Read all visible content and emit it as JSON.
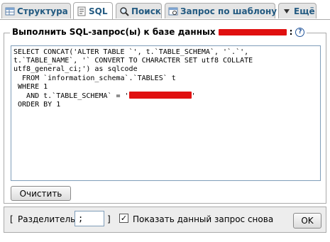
{
  "tabs": [
    {
      "label": "Структура",
      "icon": "structure-icon",
      "active": false
    },
    {
      "label": "SQL",
      "icon": "sql-icon",
      "active": true
    },
    {
      "label": "Поиск",
      "icon": "search-icon",
      "active": false
    },
    {
      "label": "Запрос по шаблону",
      "icon": "query-icon",
      "active": false
    },
    {
      "label": "Ещё",
      "icon": "chevron-down-icon",
      "active": false
    }
  ],
  "panel": {
    "legend": "Выполнить SQL-запрос(ы) к базе данных",
    "legend_suffix": ":",
    "help_icon": "help-icon",
    "sql_lines": [
      "SELECT CONCAT('ALTER TABLE `', t.`TABLE_SCHEMA`, '`.`',",
      "t.`TABLE_NAME`, '` CONVERT TO CHARACTER SET utf8 COLLATE",
      "utf8_general_ci;') as sqlcode",
      "  FROM `information_schema`.`TABLES` t",
      " WHERE 1",
      "   AND t.`TABLE_SCHEMA` = '",
      " ORDER BY 1"
    ],
    "sql_line6_suffix": "'",
    "clear_button": "Очистить"
  },
  "footer": {
    "bracket_open": "[",
    "delimiter_label": "Разделитель",
    "delimiter_value": ";",
    "bracket_close": "]",
    "show_query_checked": true,
    "show_query_label": "Показать данный запрос снова",
    "ok_button": "OK"
  },
  "colors": {
    "tab_text": "#235a81",
    "redaction": "#e01010"
  }
}
